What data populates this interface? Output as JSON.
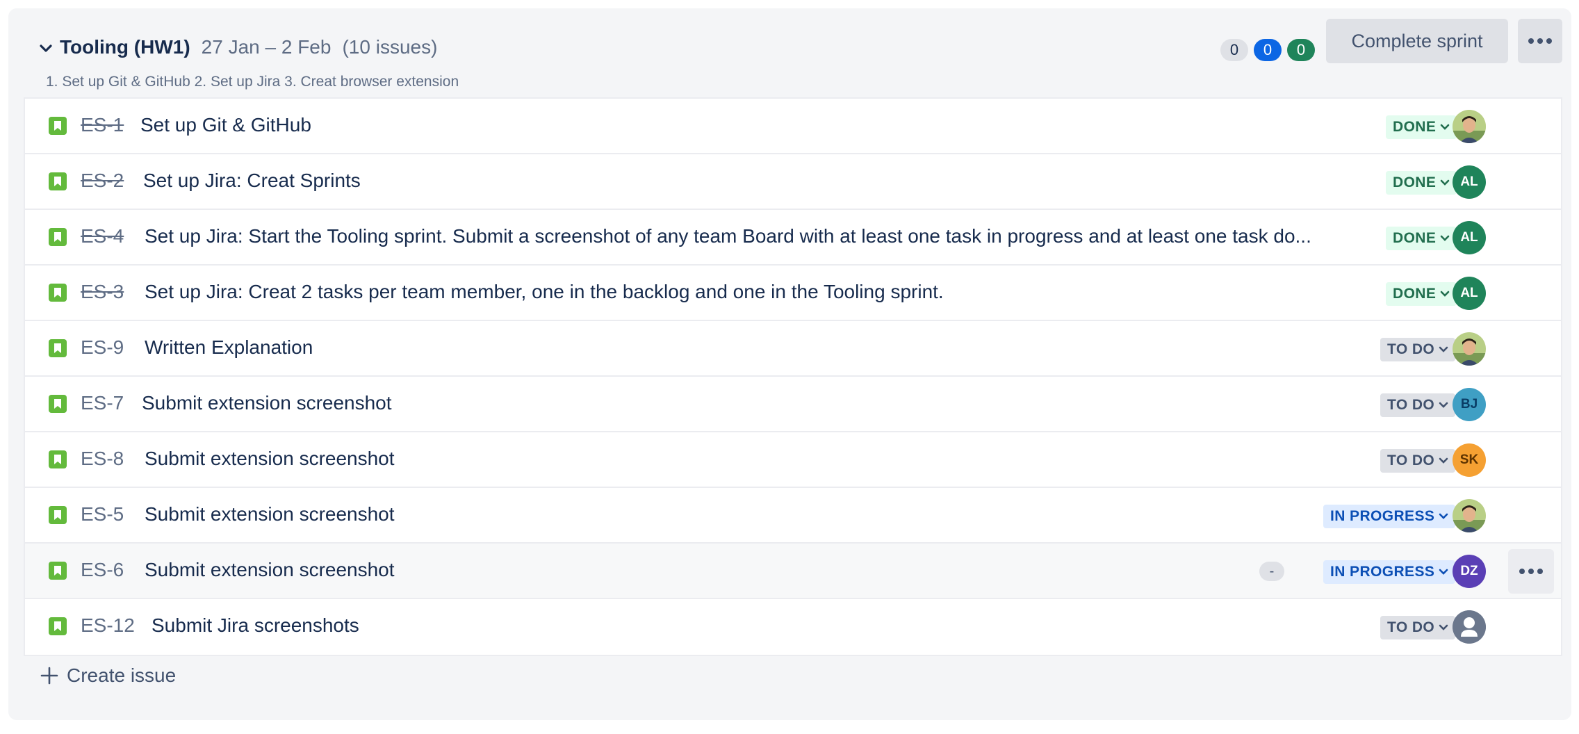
{
  "sprint": {
    "name": "Tooling (HW1)",
    "dates": "27 Jan – 2 Feb",
    "issue_count": "(10 issues)",
    "goal": "1. Set up Git & GitHub 2. Set up Jira 3. Creat browser extension",
    "counts": {
      "todo": "0",
      "in_progress": "0",
      "done": "0"
    },
    "complete_label": "Complete sprint",
    "create_issue_label": "Create issue"
  },
  "colors": {
    "story": "#63ba3c",
    "done_bg": "#e3fcef",
    "todo_bg": "#dfe1e6",
    "inprogress_bg": "#deebff",
    "avatar_al": "#1f845a",
    "avatar_bj": "#3f9fc4",
    "avatar_sk": "#f5a032",
    "avatar_dz": "#5a3fb5"
  },
  "issues": [
    {
      "key": "ES-1",
      "summary": "Set up Git & GitHub",
      "status": "DONE",
      "assignee": ""
    },
    {
      "key": "ES-2",
      "summary": "Set up Jira: Creat Sprints",
      "status": "DONE",
      "assignee": "AL"
    },
    {
      "key": "ES-4",
      "summary": "Set up Jira: Start the Tooling sprint. Submit a screenshot of any team Board with at least one task in progress and at least one task do...",
      "status": "DONE",
      "assignee": "AL"
    },
    {
      "key": "ES-3",
      "summary": "Set up Jira: Creat 2 tasks per team member, one in the backlog and one in the Tooling sprint.",
      "status": "DONE",
      "assignee": "AL"
    },
    {
      "key": "ES-9",
      "summary": "Written Explanation",
      "status": "TO DO",
      "assignee": ""
    },
    {
      "key": "ES-7",
      "summary": "Submit extension screenshot",
      "status": "TO DO",
      "assignee": "BJ"
    },
    {
      "key": "ES-8",
      "summary": "Submit extension screenshot",
      "status": "TO DO",
      "assignee": "SK"
    },
    {
      "key": "ES-5",
      "summary": "Submit extension screenshot",
      "status": "IN PROGRESS",
      "assignee": ""
    },
    {
      "key": "ES-6",
      "summary": "Submit extension screenshot",
      "status": "IN PROGRESS",
      "assignee": "DZ",
      "estimate": "-"
    },
    {
      "key": "ES-12",
      "summary": "Submit Jira screenshots",
      "status": "TO DO",
      "assignee": ""
    }
  ]
}
